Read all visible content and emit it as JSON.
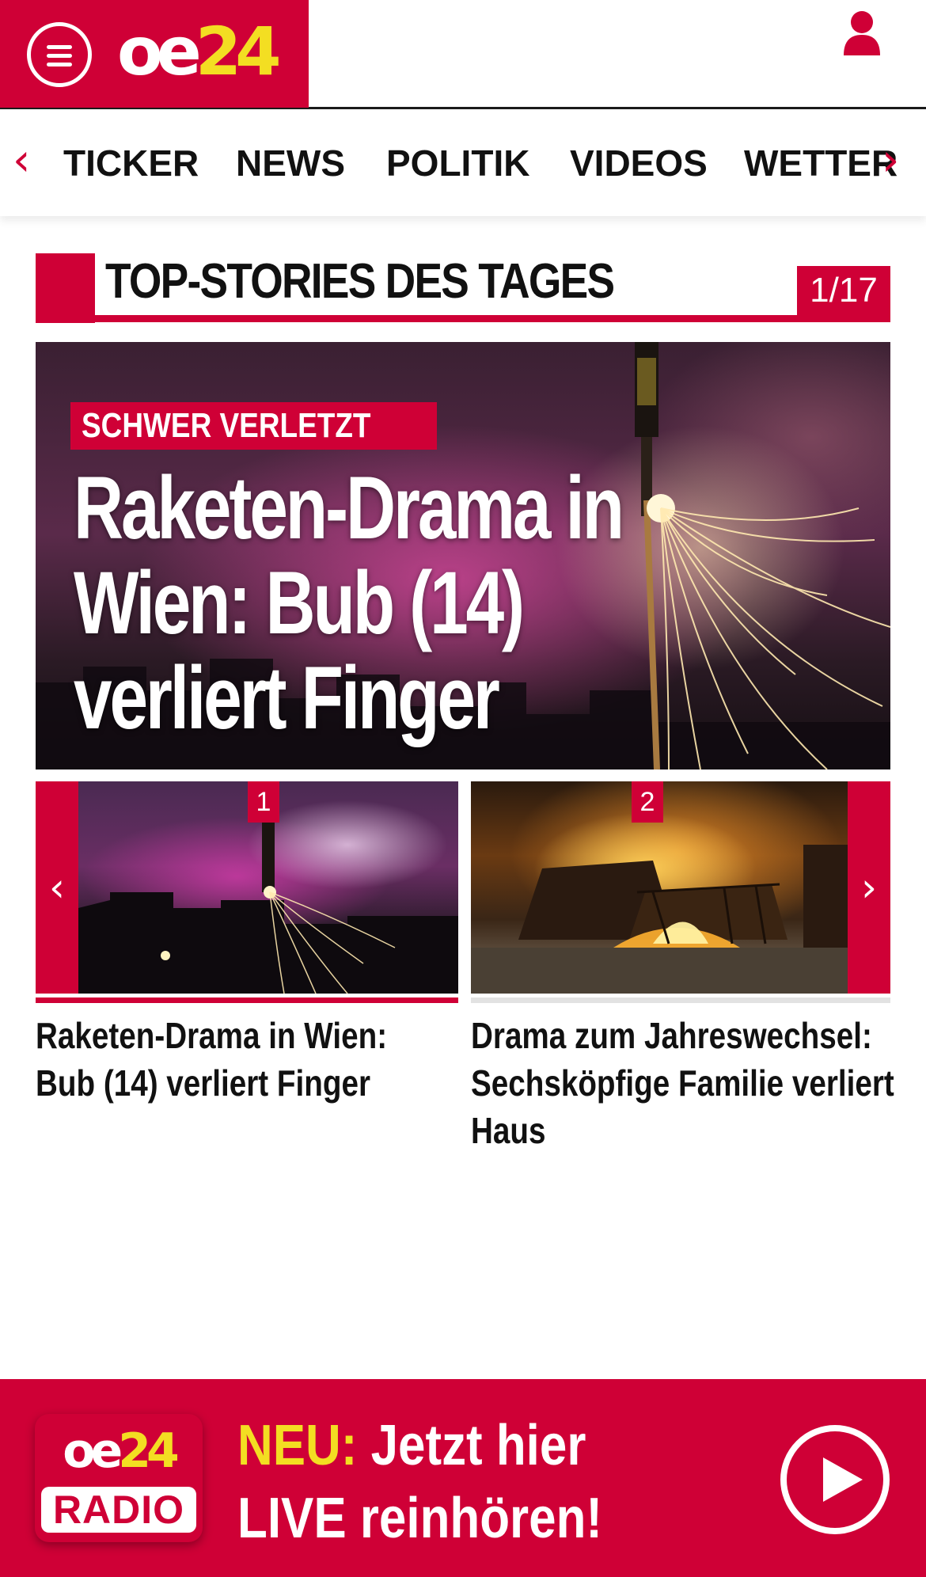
{
  "header": {
    "logo_part1": "oe",
    "logo_part2": "24",
    "menu_icon": "hamburger-menu-icon",
    "user_icon": "user-icon"
  },
  "nav": {
    "items": [
      "TICKER",
      "NEWS",
      "POLITIK",
      "VIDEOS",
      "WETTER"
    ],
    "prev_arrow": "‹",
    "next_arrow": "›"
  },
  "section": {
    "title": "TOP-STORIES DES TAGES",
    "counter": "1/17"
  },
  "hero": {
    "kicker": "SCHWER VERLETZT",
    "headline": "Raketen-Drama in Wien: Bub (14) verliert Finger"
  },
  "thumbs": [
    {
      "number": "1",
      "title": "Raketen-Drama in Wien: Bub (14) verliert Finger",
      "active": true
    },
    {
      "number": "2",
      "title": "Drama zum Jahreswechsel: Sechsköpfige Familie verliert Haus",
      "active": false
    }
  ],
  "thumb_arrows": {
    "prev": "‹",
    "next": "›"
  },
  "radio": {
    "logo_top_part1": "oe",
    "logo_top_part2": "24",
    "logo_bottom": "RADIO",
    "highlight": "NEU:",
    "line1": "Jetzt hier",
    "line2": "LIVE reinhören!"
  },
  "colors": {
    "brand_red": "#cf0036",
    "brand_yellow": "#f3de22"
  }
}
